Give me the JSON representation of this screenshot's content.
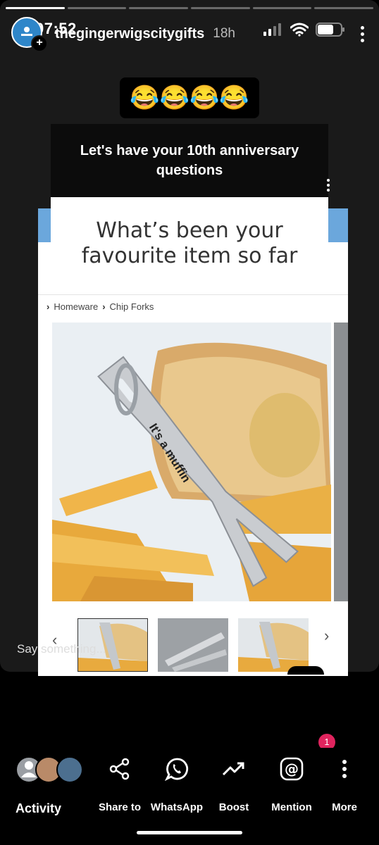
{
  "status_bar": {
    "time": "07:52"
  },
  "story": {
    "username": "thegingerwigscitygifts",
    "time_ago": "18h",
    "emojis": "😂😂😂😂",
    "reply_placeholder": "Say something...",
    "notification_count": "1"
  },
  "embedded": {
    "question": "Let's have your 10th anniversary questions",
    "headline": "What’s been your favourite item so far",
    "breadcrumbs": [
      "Homeware",
      "Chip Forks"
    ],
    "fork_engraving": "It's a muffin"
  },
  "actions": [
    {
      "label": "Activity",
      "icon": "viewers-avatars"
    },
    {
      "label": "Share to",
      "icon": "share-icon"
    },
    {
      "label": "WhatsApp",
      "icon": "whatsapp-icon"
    },
    {
      "label": "Boost",
      "icon": "trending-up-icon"
    },
    {
      "label": "Mention",
      "icon": "at-icon"
    },
    {
      "label": "More",
      "icon": "more-vertical-icon"
    }
  ],
  "colors": {
    "badge": "#e0245e",
    "accent_blue": "#6ba7dc",
    "avatar_bg": "#2e86c9"
  }
}
